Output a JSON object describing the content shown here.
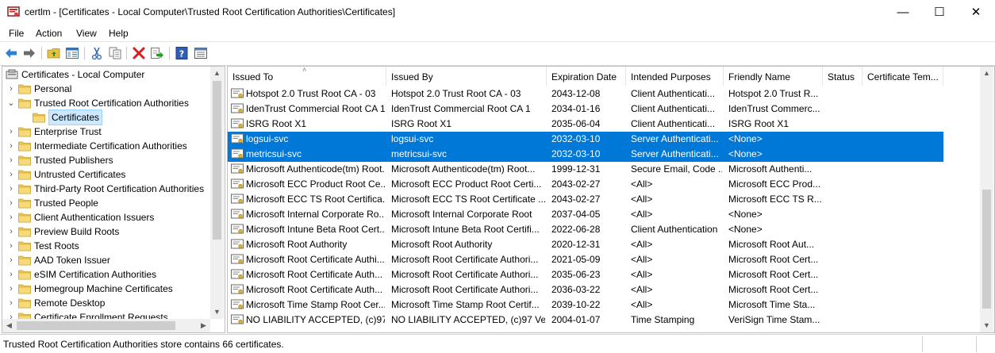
{
  "window": {
    "title": "certlm - [Certificates - Local Computer\\Trusted Root Certification Authorities\\Certificates]",
    "minimize": "—",
    "maximize": "☐",
    "close": "✕"
  },
  "menu": [
    "File",
    "Action",
    "View",
    "Help"
  ],
  "toolbar": [
    "back-icon",
    "forward-icon",
    "up-folder-icon",
    "show-hide-tree-icon",
    "cut-icon",
    "copy-icon",
    "delete-icon",
    "export-icon",
    "help-icon",
    "properties-icon"
  ],
  "tree": {
    "root": "Certificates - Local Computer",
    "items": [
      {
        "label": "Personal",
        "expanded": false
      },
      {
        "label": "Trusted Root Certification Authorities",
        "expanded": true
      },
      {
        "label": "Certificates",
        "child": true,
        "selected": true
      },
      {
        "label": "Enterprise Trust",
        "expanded": false
      },
      {
        "label": "Intermediate Certification Authorities",
        "expanded": false
      },
      {
        "label": "Trusted Publishers",
        "expanded": false
      },
      {
        "label": "Untrusted Certificates",
        "expanded": false
      },
      {
        "label": "Third-Party Root Certification Authorities",
        "expanded": false
      },
      {
        "label": "Trusted People",
        "expanded": false
      },
      {
        "label": "Client Authentication Issuers",
        "expanded": false
      },
      {
        "label": "Preview Build Roots",
        "expanded": false
      },
      {
        "label": "Test Roots",
        "expanded": false
      },
      {
        "label": "AAD Token Issuer",
        "expanded": false
      },
      {
        "label": "eSIM Certification Authorities",
        "expanded": false
      },
      {
        "label": "Homegroup Machine Certificates",
        "expanded": false
      },
      {
        "label": "Remote Desktop",
        "expanded": false
      },
      {
        "label": "Certificate Enrollment Requests",
        "expanded": false
      }
    ]
  },
  "list": {
    "columns": [
      "Issued To",
      "Issued By",
      "Expiration Date",
      "Intended Purposes",
      "Friendly Name",
      "Status",
      "Certificate Tem..."
    ],
    "rows": [
      {
        "issued_to": "Hotspot 2.0 Trust Root CA - 03",
        "issued_by": "Hotspot 2.0 Trust Root CA - 03",
        "expires": "2043-12-08",
        "purposes": "Client Authenticati...",
        "friendly": "Hotspot 2.0 Trust R...",
        "status": "",
        "template": ""
      },
      {
        "issued_to": "IdenTrust Commercial Root CA 1",
        "issued_by": "IdenTrust Commercial Root CA 1",
        "expires": "2034-01-16",
        "purposes": "Client Authenticati...",
        "friendly": "IdenTrust Commerc...",
        "status": "",
        "template": ""
      },
      {
        "issued_to": "ISRG Root X1",
        "issued_by": "ISRG Root X1",
        "expires": "2035-06-04",
        "purposes": "Client Authenticati...",
        "friendly": "ISRG Root X1",
        "status": "",
        "template": ""
      },
      {
        "issued_to": "logsui-svc",
        "issued_by": "logsui-svc",
        "expires": "2032-03-10",
        "purposes": "Server Authenticati...",
        "friendly": "<None>",
        "status": "",
        "template": "",
        "selected": true
      },
      {
        "issued_to": "metricsui-svc",
        "issued_by": "metricsui-svc",
        "expires": "2032-03-10",
        "purposes": "Server Authenticati...",
        "friendly": "<None>",
        "status": "",
        "template": "",
        "selected": true
      },
      {
        "issued_to": "Microsoft Authenticode(tm) Root...",
        "issued_by": "Microsoft Authenticode(tm) Root...",
        "expires": "1999-12-31",
        "purposes": "Secure Email, Code ...",
        "friendly": "Microsoft Authenti...",
        "status": "",
        "template": ""
      },
      {
        "issued_to": "Microsoft ECC Product Root Ce...",
        "issued_by": "Microsoft ECC Product Root Certi...",
        "expires": "2043-02-27",
        "purposes": "<All>",
        "friendly": "Microsoft ECC Prod...",
        "status": "",
        "template": ""
      },
      {
        "issued_to": "Microsoft ECC TS Root Certifica...",
        "issued_by": "Microsoft ECC TS Root Certificate ...",
        "expires": "2043-02-27",
        "purposes": "<All>",
        "friendly": "Microsoft ECC TS R...",
        "status": "",
        "template": ""
      },
      {
        "issued_to": "Microsoft Internal Corporate Ro...",
        "issued_by": "Microsoft Internal Corporate Root",
        "expires": "2037-04-05",
        "purposes": "<All>",
        "friendly": "<None>",
        "status": "",
        "template": ""
      },
      {
        "issued_to": "Microsoft Intune Beta Root Cert...",
        "issued_by": "Microsoft Intune Beta Root Certifi...",
        "expires": "2022-06-28",
        "purposes": "Client Authentication",
        "friendly": "<None>",
        "status": "",
        "template": ""
      },
      {
        "issued_to": "Microsoft Root Authority",
        "issued_by": "Microsoft Root Authority",
        "expires": "2020-12-31",
        "purposes": "<All>",
        "friendly": "Microsoft Root Aut...",
        "status": "",
        "template": ""
      },
      {
        "issued_to": "Microsoft Root Certificate Authi...",
        "issued_by": "Microsoft Root Certificate Authori...",
        "expires": "2021-05-09",
        "purposes": "<All>",
        "friendly": "Microsoft Root Cert...",
        "status": "",
        "template": ""
      },
      {
        "issued_to": "Microsoft Root Certificate Auth...",
        "issued_by": "Microsoft Root Certificate Authori...",
        "expires": "2035-06-23",
        "purposes": "<All>",
        "friendly": "Microsoft Root Cert...",
        "status": "",
        "template": ""
      },
      {
        "issued_to": "Microsoft Root Certificate Auth...",
        "issued_by": "Microsoft Root Certificate Authori...",
        "expires": "2036-03-22",
        "purposes": "<All>",
        "friendly": "Microsoft Root Cert...",
        "status": "",
        "template": ""
      },
      {
        "issued_to": "Microsoft Time Stamp Root Cer...",
        "issued_by": "Microsoft Time Stamp Root Certif...",
        "expires": "2039-10-22",
        "purposes": "<All>",
        "friendly": "Microsoft Time Sta...",
        "status": "",
        "template": ""
      },
      {
        "issued_to": "NO LIABILITY ACCEPTED, (c)97 ...",
        "issued_by": "NO LIABILITY ACCEPTED, (c)97 Ve...",
        "expires": "2004-01-07",
        "purposes": "Time Stamping",
        "friendly": "VeriSign Time Stam...",
        "status": "",
        "template": ""
      }
    ]
  },
  "status": "Trusted Root Certification Authorities store contains 66 certificates.",
  "colors": {
    "selection": "#0078d7",
    "tree_selection": "#cce8ff",
    "folder": "#e8c046"
  }
}
